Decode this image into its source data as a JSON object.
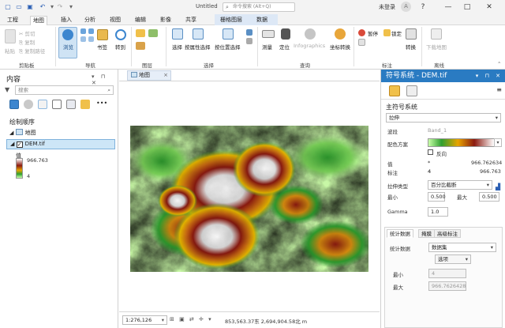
{
  "window": {
    "title": "Untitled",
    "search_placeholder": "命令搜索 (Alt+Q)",
    "signin": "未登录",
    "avatar_glyph": "A",
    "help": "?",
    "minimize": "—",
    "maximize": "□",
    "close": "✕"
  },
  "ribbon_tabs": [
    "工程",
    "地图",
    "插入",
    "分析",
    "视图",
    "编辑",
    "影像",
    "共享",
    "栅格图层",
    "数据"
  ],
  "ribbon": {
    "clipboard": {
      "paste": "粘贴",
      "cut": "剪切",
      "copy": "复制",
      "copy_path": "复制路径",
      "group": "剪贴板"
    },
    "navigate": {
      "explore": "浏览",
      "bookmarks": "书签",
      "goto": "转到",
      "group": "导航"
    },
    "layer": {
      "group": "图层"
    },
    "selection": {
      "select": "选择",
      "select_by_attr": "按属性选择",
      "select_by_loc": "按位置选择",
      "group": "选择"
    },
    "inquiry": {
      "measure": "测量",
      "locate": "定位",
      "infographics": "Infographics",
      "coordinate_conv": "坐标转换",
      "group": "查询"
    },
    "labeling": {
      "pause": "暂停",
      "lock": "锁定",
      "convert": "转换",
      "group": "标注"
    },
    "offline": {
      "download_map": "下载地图",
      "group": "离线"
    }
  },
  "contents": {
    "title": "内容",
    "search_placeholder": "搜索",
    "drawing_order": "绘制顺序",
    "map_name": "地图",
    "layer_name": "DEM.tif",
    "legend_title": "值",
    "legend_max": "966.763",
    "legend_min": "4"
  },
  "map": {
    "tab_label": "地图",
    "scale": "1:276,126",
    "coords": "853,563.37东 2,694,904.58北 m"
  },
  "symbology": {
    "title": "符号系统 - DEM.tif",
    "primary_label": "主符号系统",
    "renderer": "拉伸",
    "band_label": "波段",
    "band_value": "Band_1",
    "scheme_label": "配色方案",
    "invert_label": "反向",
    "value_label": "值",
    "value_max": "966.762634",
    "value_min_num": "4",
    "label_label": "标注",
    "label_min": "4",
    "label_max": "966.763",
    "stretch_type_label": "拉伸类型",
    "stretch_type": "百分比截断",
    "min_label": "最小",
    "min_value": "0.500",
    "max_label": "最大",
    "max_value": "0.500",
    "gamma_label": "Gamma",
    "gamma_value": "1.0",
    "tabs": [
      "统计数据",
      "掩膜",
      "高级标注"
    ],
    "stats_label": "统计数据",
    "stats_source": "数据集",
    "options_button": "选项",
    "stat_min_label": "最小",
    "stat_min_value": "4",
    "stat_max_label": "最大",
    "stat_max_value": "966.7626428"
  },
  "colors": {
    "accent": "#2a7bc2",
    "selection": "#cde6f7"
  }
}
